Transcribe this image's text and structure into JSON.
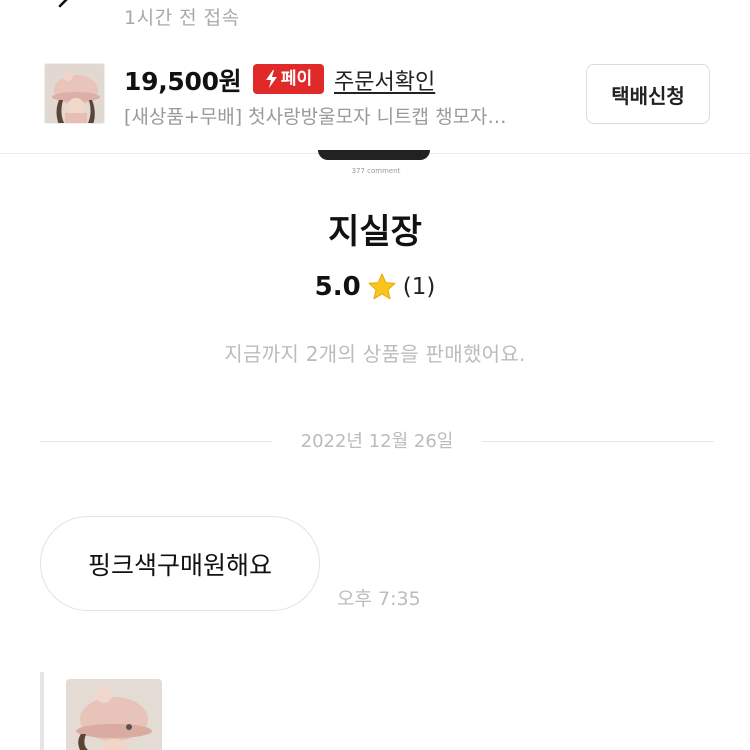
{
  "header": {
    "last_seen": "1시간 전 접속",
    "back_icon": "back-arrow-icon"
  },
  "product": {
    "price": "19,500원",
    "pay_badge": "페이",
    "order_link": "주문서확인",
    "title": "[새상품+무배] 첫사랑방울모자 니트캡 챙모자…",
    "delivery_button": "택배신청",
    "thumbnail": "knit-hat-photo"
  },
  "seller": {
    "profile_caption": "377 comment",
    "name": "지실장",
    "rating": "5.0",
    "review_count": "(1)",
    "sales_summary": "지금까지 2개의 상품을 판매했어요."
  },
  "chat": {
    "date": "2022년 12월 26일",
    "messages": [
      {
        "text": "핑크색구매원해요",
        "time": "오후 7:35"
      }
    ]
  },
  "colors": {
    "accent_red": "#e02a2a",
    "star": "#f7c51e",
    "muted_text": "#bcbcbc"
  }
}
